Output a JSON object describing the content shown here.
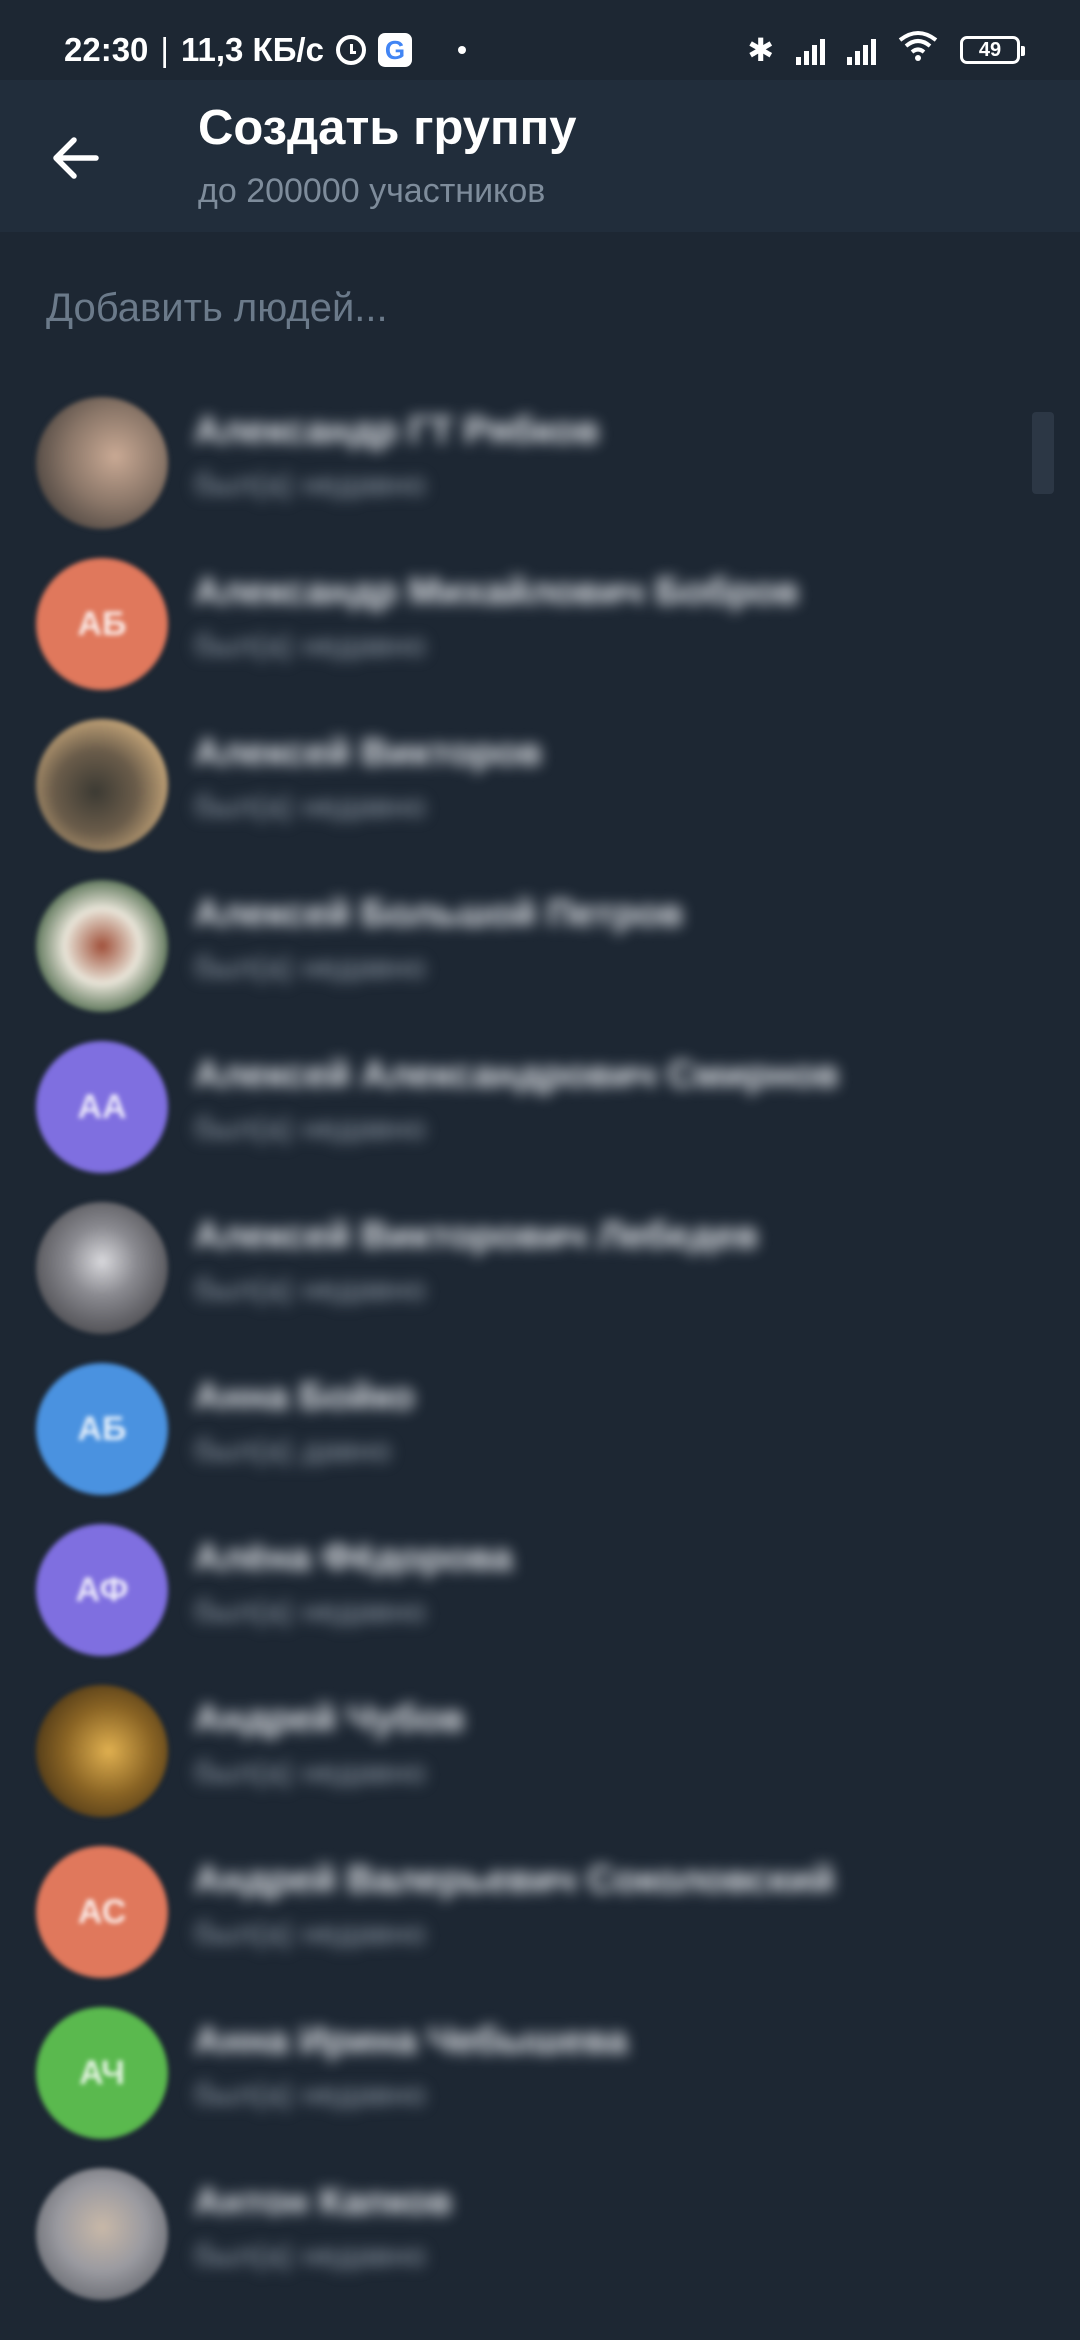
{
  "status_bar": {
    "time": "22:30",
    "separator": "|",
    "speed": "11,3 КБ/с",
    "google_letter": "G",
    "bluetooth_glyph": "✱",
    "wifi_glyph": "◠",
    "battery": "49",
    "icons": [
      "alarm-icon",
      "google-icon",
      "dot-icon",
      "bluetooth-icon",
      "signal-icon",
      "signal-icon",
      "wifi-icon",
      "battery-icon"
    ]
  },
  "header": {
    "title": "Создать группу",
    "subtitle": "до 200000 участников"
  },
  "search": {
    "placeholder": "Добавить людей..."
  },
  "contacts": [
    {
      "name": "Александр ГТ Рябков",
      "status": "был(а) недавно",
      "avatar_initials": "",
      "avatar_color": "#8a7668"
    },
    {
      "name": "Александр Михайлович Бобров",
      "status": "был(а) недавно",
      "avatar_initials": "АБ",
      "avatar_color": "#e0785c"
    },
    {
      "name": "Алексей Викторов",
      "status": "был(а) недавно",
      "avatar_initials": "",
      "avatar_color": "#6a5c4a"
    },
    {
      "name": "Алексей Большой Петров",
      "status": "был(а) недавно",
      "avatar_initials": "",
      "avatar_color": "#7a7a62"
    },
    {
      "name": "Алексей Александрович Смирнов",
      "status": "был(а) недавно",
      "avatar_initials": "АА",
      "avatar_color": "#7f6fe0"
    },
    {
      "name": "Алексей Викторович Лебедев",
      "status": "был(а) недавно",
      "avatar_initials": "",
      "avatar_color": "#6e6e72"
    },
    {
      "name": "Анна Бойко",
      "status": "был(а) давно",
      "avatar_initials": "АБ",
      "avatar_color": "#4a92e0"
    },
    {
      "name": "Алёна Фёдорова",
      "status": "был(а) недавно",
      "avatar_initials": "АФ",
      "avatar_color": "#7f6fe0"
    },
    {
      "name": "Андрей Чубов",
      "status": "был(а) недавно",
      "avatar_initials": "",
      "avatar_color": "#8a6424"
    },
    {
      "name": "Андрей Валерьевич Соколовский",
      "status": "был(а) недавно",
      "avatar_initials": "АС",
      "avatar_color": "#e0785c"
    },
    {
      "name": "Анна Ирина Чебышева",
      "status": "был(а) недавно",
      "avatar_initials": "АЧ",
      "avatar_color": "#5ab94e"
    },
    {
      "name": "Антон Капков",
      "status": "был(а) недавно",
      "avatar_initials": "",
      "avatar_color": "#9a9aa0"
    }
  ]
}
